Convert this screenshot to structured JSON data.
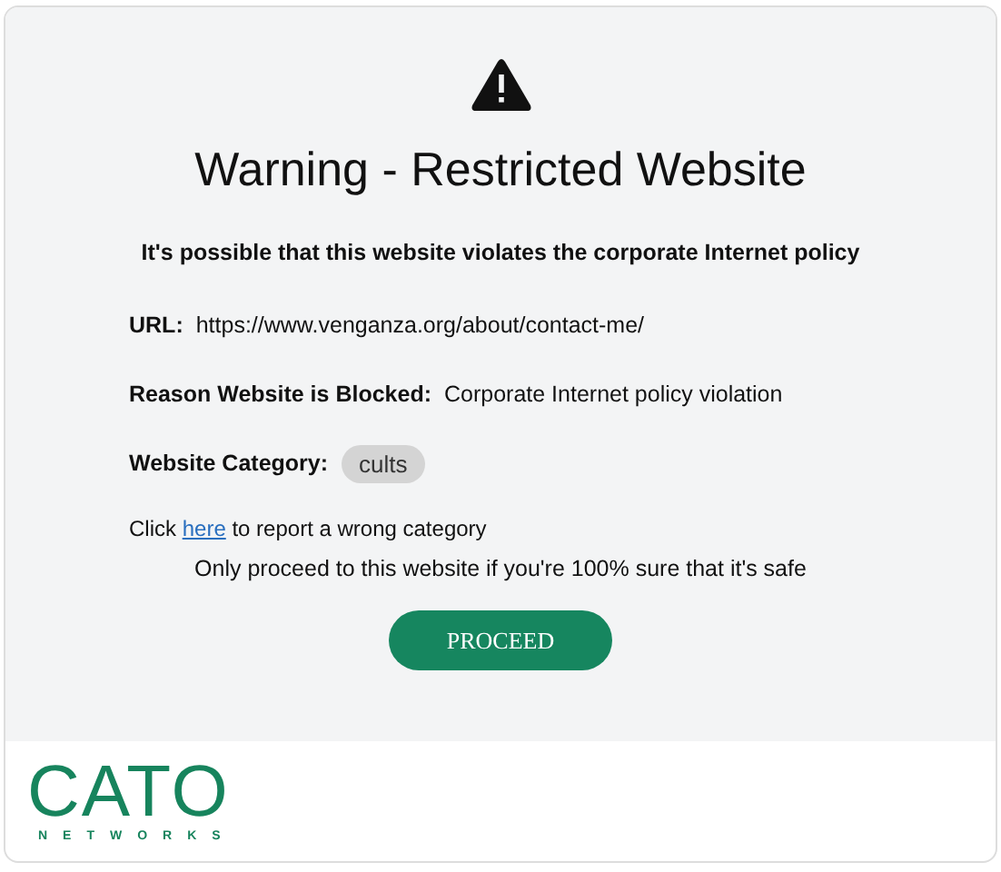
{
  "title": "Warning - Restricted Website",
  "subtitle": "It's possible that this website violates the corporate Internet policy",
  "fields": [
    {
      "label": "URL:",
      "value": "https://www.venganza.org/about/contact-me/",
      "kind": "text"
    },
    {
      "label": "Reason Website is Blocked:",
      "value": "Corporate Internet policy violation",
      "kind": "text"
    },
    {
      "label": "Website Category:",
      "value": "cults",
      "kind": "tag"
    }
  ],
  "report": {
    "before": "Click",
    "link": "here",
    "after": "to report a wrong category"
  },
  "notice": "Only proceed to this website if you're 100% sure that it's safe",
  "button": "PROCEED",
  "logo": {
    "name": "CATO",
    "sub": "NETWORKS"
  }
}
